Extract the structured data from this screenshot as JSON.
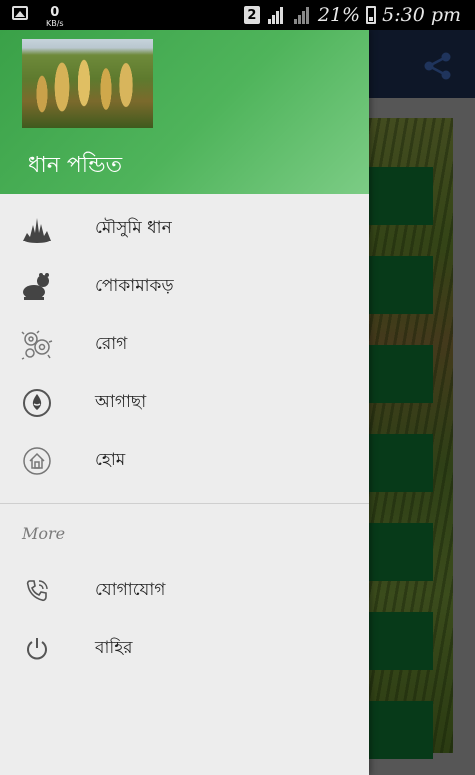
{
  "status_bar": {
    "net_speed_value": "0",
    "net_speed_unit": "KB/s",
    "sim_label": "2",
    "battery": "21%",
    "time": "5:30 pm"
  },
  "drawer": {
    "title": "ধান পন্ডিত",
    "items": [
      {
        "label": "মৌসুমি ধান",
        "icon": "rice-seedling-icon"
      },
      {
        "label": "পোকামাকড়",
        "icon": "insect-icon"
      },
      {
        "label": "রোগ",
        "icon": "germ-icon"
      },
      {
        "label": "আগাছা",
        "icon": "weed-drop-icon"
      },
      {
        "label": "হোম",
        "icon": "home-icon"
      }
    ],
    "section_title": "More",
    "more_items": [
      {
        "label": "যোগাযোগ",
        "icon": "phone-icon"
      },
      {
        "label": "বাহির",
        "icon": "power-icon"
      }
    ]
  },
  "background": {
    "toolbar_color": "#1b2b4a",
    "button_color": "#0e6a2e",
    "share_icon": "share-icon"
  },
  "colors": {
    "header_green": "#4fb45b",
    "drawer_bg": "#ededed"
  }
}
